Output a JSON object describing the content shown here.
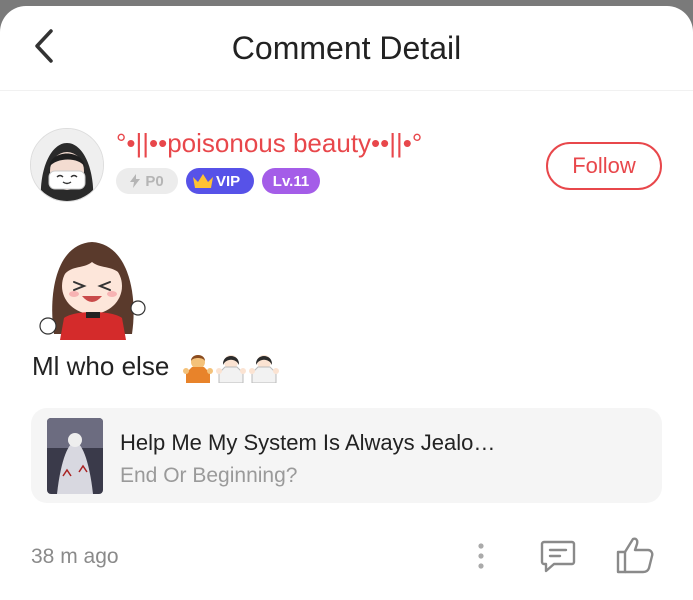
{
  "header": {
    "title": "Comment Detail",
    "back_icon": "chevron-left-icon"
  },
  "user": {
    "name": "°•||••poisonous beauty••||•°",
    "badges": {
      "power": "P0",
      "vip": "VIP",
      "level": "Lv.11"
    },
    "follow_label": "Follow"
  },
  "comment": {
    "text": "Ml who else"
  },
  "book": {
    "title": "Help Me My System Is Always Jealo…",
    "chapter": "End Or Beginning?"
  },
  "footer": {
    "time": "38 m ago"
  },
  "colors": {
    "accent": "#e8474b",
    "vip": "#5752e8",
    "level": "#a45de8",
    "card_bg": "#f5f5f5"
  }
}
